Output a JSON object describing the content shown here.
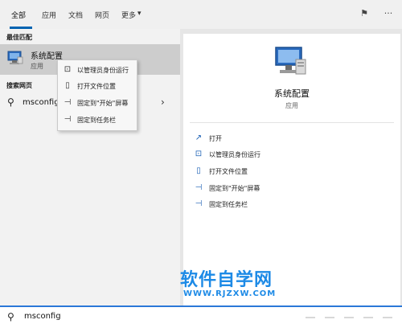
{
  "tabs": [
    {
      "label": "全部",
      "active": true
    },
    {
      "label": "应用",
      "active": false
    },
    {
      "label": "文档",
      "active": false
    },
    {
      "label": "网页",
      "active": false
    },
    {
      "label": "更多",
      "active": false
    }
  ],
  "tab_more_arrow": "▾",
  "top_icons": {
    "feedback": "feedback-icon",
    "more": "ellipsis-icon",
    "feedback_glyph": "⚑",
    "more_glyph": "···"
  },
  "left": {
    "best_match_title": "最佳匹配",
    "best_match": {
      "name": "系统配置",
      "sub": "应用",
      "icon": "system-config-icon"
    },
    "web_title": "搜索网页",
    "web_item": {
      "text": "msconfig",
      "icon_glyph": "⚲",
      "chevron": "›"
    }
  },
  "context_menu": {
    "items": [
      {
        "label": "以管理员身份运行",
        "icon": "run-as-admin-icon",
        "glyph": "⊡"
      },
      {
        "label": "打开文件位置",
        "icon": "open-file-location-icon",
        "glyph": "▯"
      },
      {
        "label": "固定到\"开始\"屏幕",
        "icon": "pin-to-start-icon",
        "glyph": "⊣"
      },
      {
        "label": "固定到任务栏",
        "icon": "pin-to-taskbar-icon",
        "glyph": "⊣"
      }
    ]
  },
  "right": {
    "app_title": "系统配置",
    "app_sub": "应用",
    "actions": [
      {
        "label": "打开",
        "icon": "open-icon",
        "glyph": "↗"
      },
      {
        "label": "以管理员身份运行",
        "icon": "run-as-admin-icon",
        "glyph": "⊡"
      },
      {
        "label": "打开文件位置",
        "icon": "open-file-location-icon",
        "glyph": "▯"
      },
      {
        "label": "固定到\"开始\"屏幕",
        "icon": "pin-to-start-icon",
        "glyph": "⊣"
      },
      {
        "label": "固定到任务栏",
        "icon": "pin-to-taskbar-icon",
        "glyph": "⊣"
      }
    ]
  },
  "watermark": {
    "line1": "软件自学网",
    "line2": "WWW.RJZXW.COM"
  },
  "search": {
    "value": "msconfig",
    "icon_glyph": "⚲"
  },
  "colors": {
    "accent": "#0063b1",
    "watermark": "#1d8ae6",
    "selected_bg": "#cdcdcd"
  }
}
